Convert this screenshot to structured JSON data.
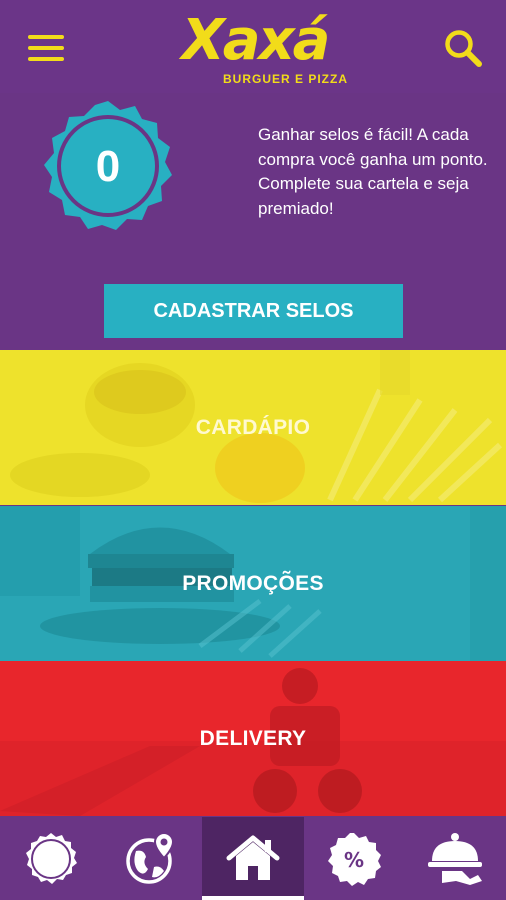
{
  "header": {
    "brand": "Xaxá",
    "brand_subtitle": "BURGUER E PIZZA",
    "menu_icon": "hamburger-menu-icon",
    "search_icon": "search-icon",
    "accent_color": "#f2dc1a",
    "bar_color": "#6b3588"
  },
  "stamps": {
    "count": "0",
    "info": "Ganhar selos é fácil! A cada compra você ganha um ponto. Complete sua cartela e seja premiado!",
    "register_label": "CADASTRAR SELOS",
    "badge_color": "#28b0c2"
  },
  "tiles": {
    "menu": "CARDÁPIO",
    "promotions": "PROMOÇÕES",
    "delivery": "DELIVERY",
    "colors": {
      "menu": "#eee22c",
      "promotions": "#2aa6b5",
      "delivery": "#e8262c"
    }
  },
  "bottom_nav": {
    "items": [
      "stamp-badge-icon",
      "globe-location-icon",
      "home-icon",
      "percent-discount-icon",
      "delivery-cloche-icon"
    ],
    "active": "home-icon"
  }
}
